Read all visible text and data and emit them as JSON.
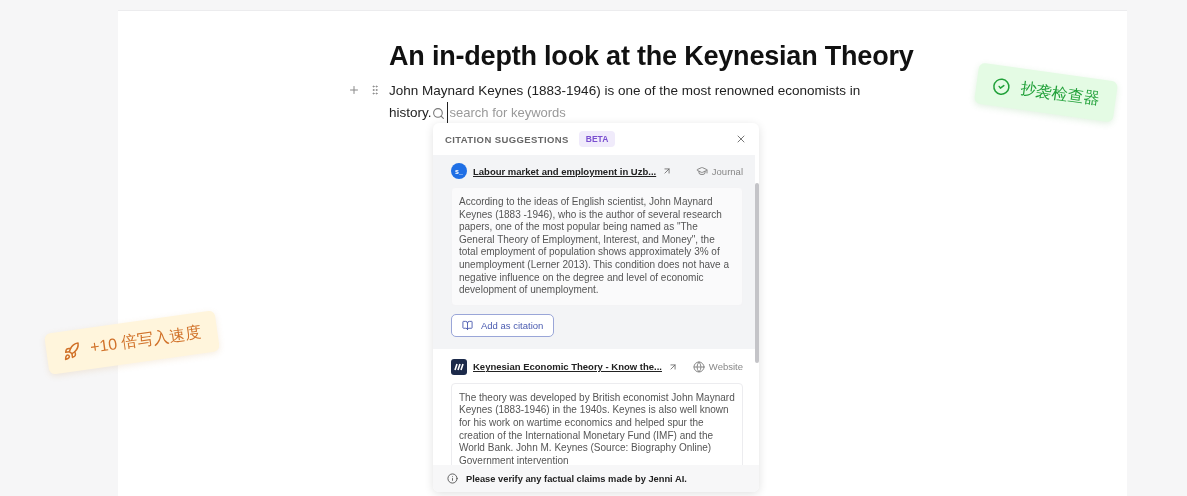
{
  "document": {
    "title": "An in-depth look at the Keynesian Theory",
    "paragraph_text": "John Maynard Keynes (1883-1946) is one of the most renowned economists in",
    "paragraph_end": "history.",
    "search": {
      "placeholder": "search for keywords"
    }
  },
  "citation_panel": {
    "title": "CITATION SUGGESTIONS",
    "badge": "BETA",
    "results": [
      {
        "source_logo": {
          "kind": "letters",
          "text": "s_"
        },
        "title": "Labour market and employment in Uzb...",
        "type": "Journal",
        "excerpt": "According to the ideas of English scientist, John Maynard Keynes (1883 -1946), who is the author of several research papers, one of the most popular being named as \"The General Theory of Employment, Interest, and Money\", the total employment of population shows approximately 3% of unemployment (Lerner 2013). This condition does not have a negative influence on the degree and level of economic development of unemployment.",
        "action": "Add as citation",
        "highlighted": true
      },
      {
        "source_logo": {
          "kind": "mark"
        },
        "title": "Keynesian Economic Theory - Know the...",
        "type": "Website",
        "excerpt": "The theory was developed by British economist John Maynard Keynes (1883-1946) in the 1940s. Keynes is also well known for his work on wartime economics and helped spur the creation of the International Monetary Fund (IMF) and the World Bank. John M. Keynes (Source: Biography Online) Government intervention",
        "highlighted": false
      }
    ],
    "footer": "Please verify any factual claims made by Jenni AI."
  },
  "badges": [
    {
      "kind": "check",
      "text": "抄袭检查器"
    },
    {
      "kind": "rocket",
      "text": "+10 倍写入速度"
    }
  ]
}
